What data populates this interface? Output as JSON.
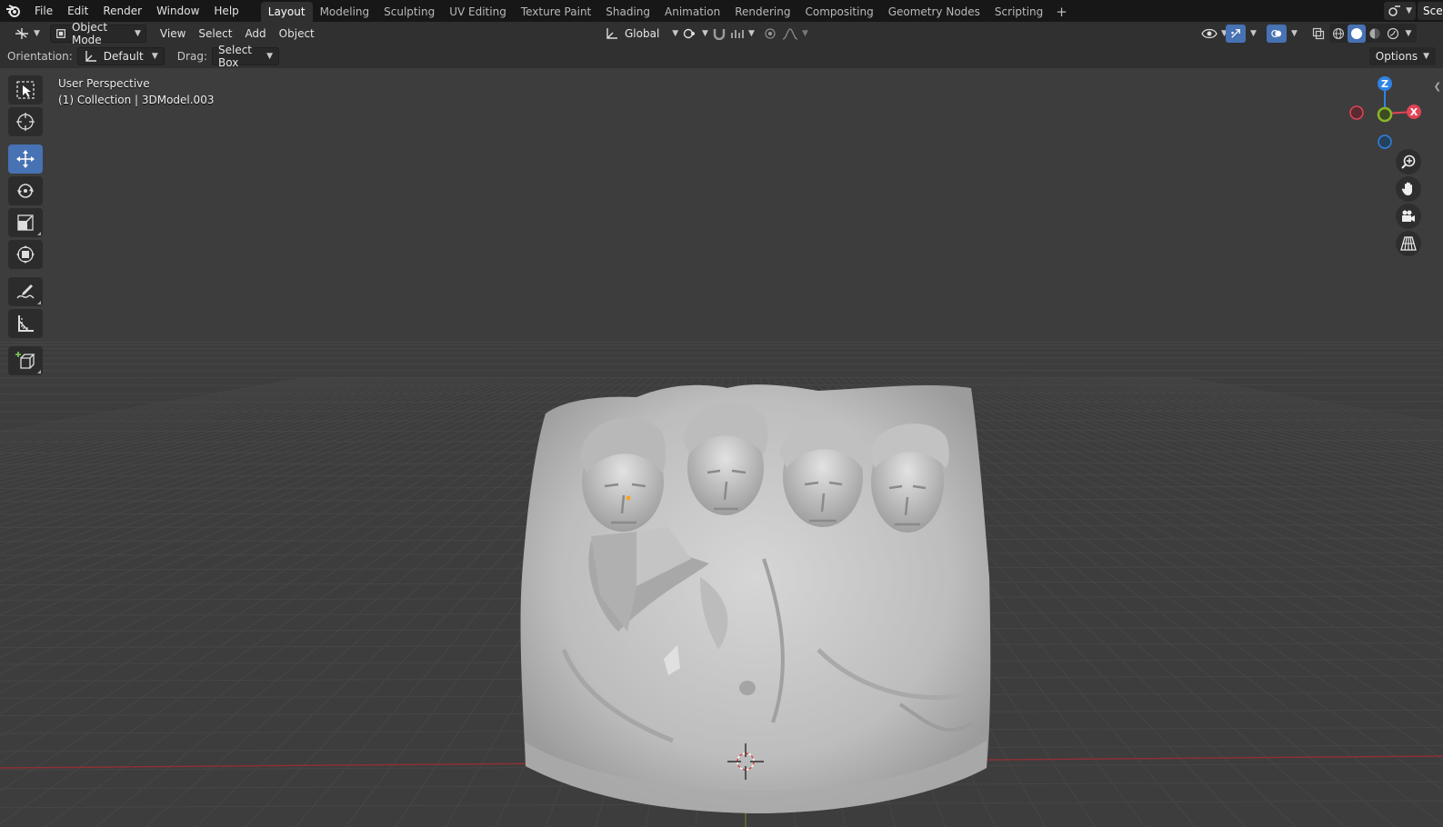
{
  "topbar": {
    "menus": [
      "File",
      "Edit",
      "Render",
      "Window",
      "Help"
    ],
    "workspaces": [
      "Layout",
      "Modeling",
      "Sculpting",
      "UV Editing",
      "Texture Paint",
      "Shading",
      "Animation",
      "Rendering",
      "Compositing",
      "Geometry Nodes",
      "Scripting"
    ],
    "active_workspace": "Layout",
    "add_workspace": "+",
    "scene_label": "Scen"
  },
  "header": {
    "mode": "Object Mode",
    "menus": [
      "View",
      "Select",
      "Add",
      "Object"
    ],
    "transform_orientation": "Global"
  },
  "tool_settings": {
    "orientation_label": "Orientation:",
    "orientation_value": "Default",
    "drag_label": "Drag:",
    "drag_value": "Select Box",
    "options_label": "Options"
  },
  "viewport": {
    "perspective": "User Perspective",
    "collection_info": "(1) Collection | 3DModel.003"
  },
  "gizmo": {
    "z_label": "Z",
    "x_label": "X",
    "colors": {
      "x": "#e04556",
      "y": "#8ab62a",
      "z": "#2f83e3"
    }
  },
  "colors": {
    "accent": "#4772b3",
    "background": "#3d3d3d",
    "grid": "#464646",
    "x_axis": "#a0343a"
  },
  "icons": [
    "blender-logo-icon",
    "select-box-icon",
    "cursor-icon",
    "move-icon",
    "rotate-icon",
    "scale-icon",
    "transform-icon",
    "annotate-icon",
    "measure-icon",
    "add-cube-icon",
    "zoom-icon",
    "hand-pan-icon",
    "camera-icon",
    "grid-view-icon"
  ]
}
